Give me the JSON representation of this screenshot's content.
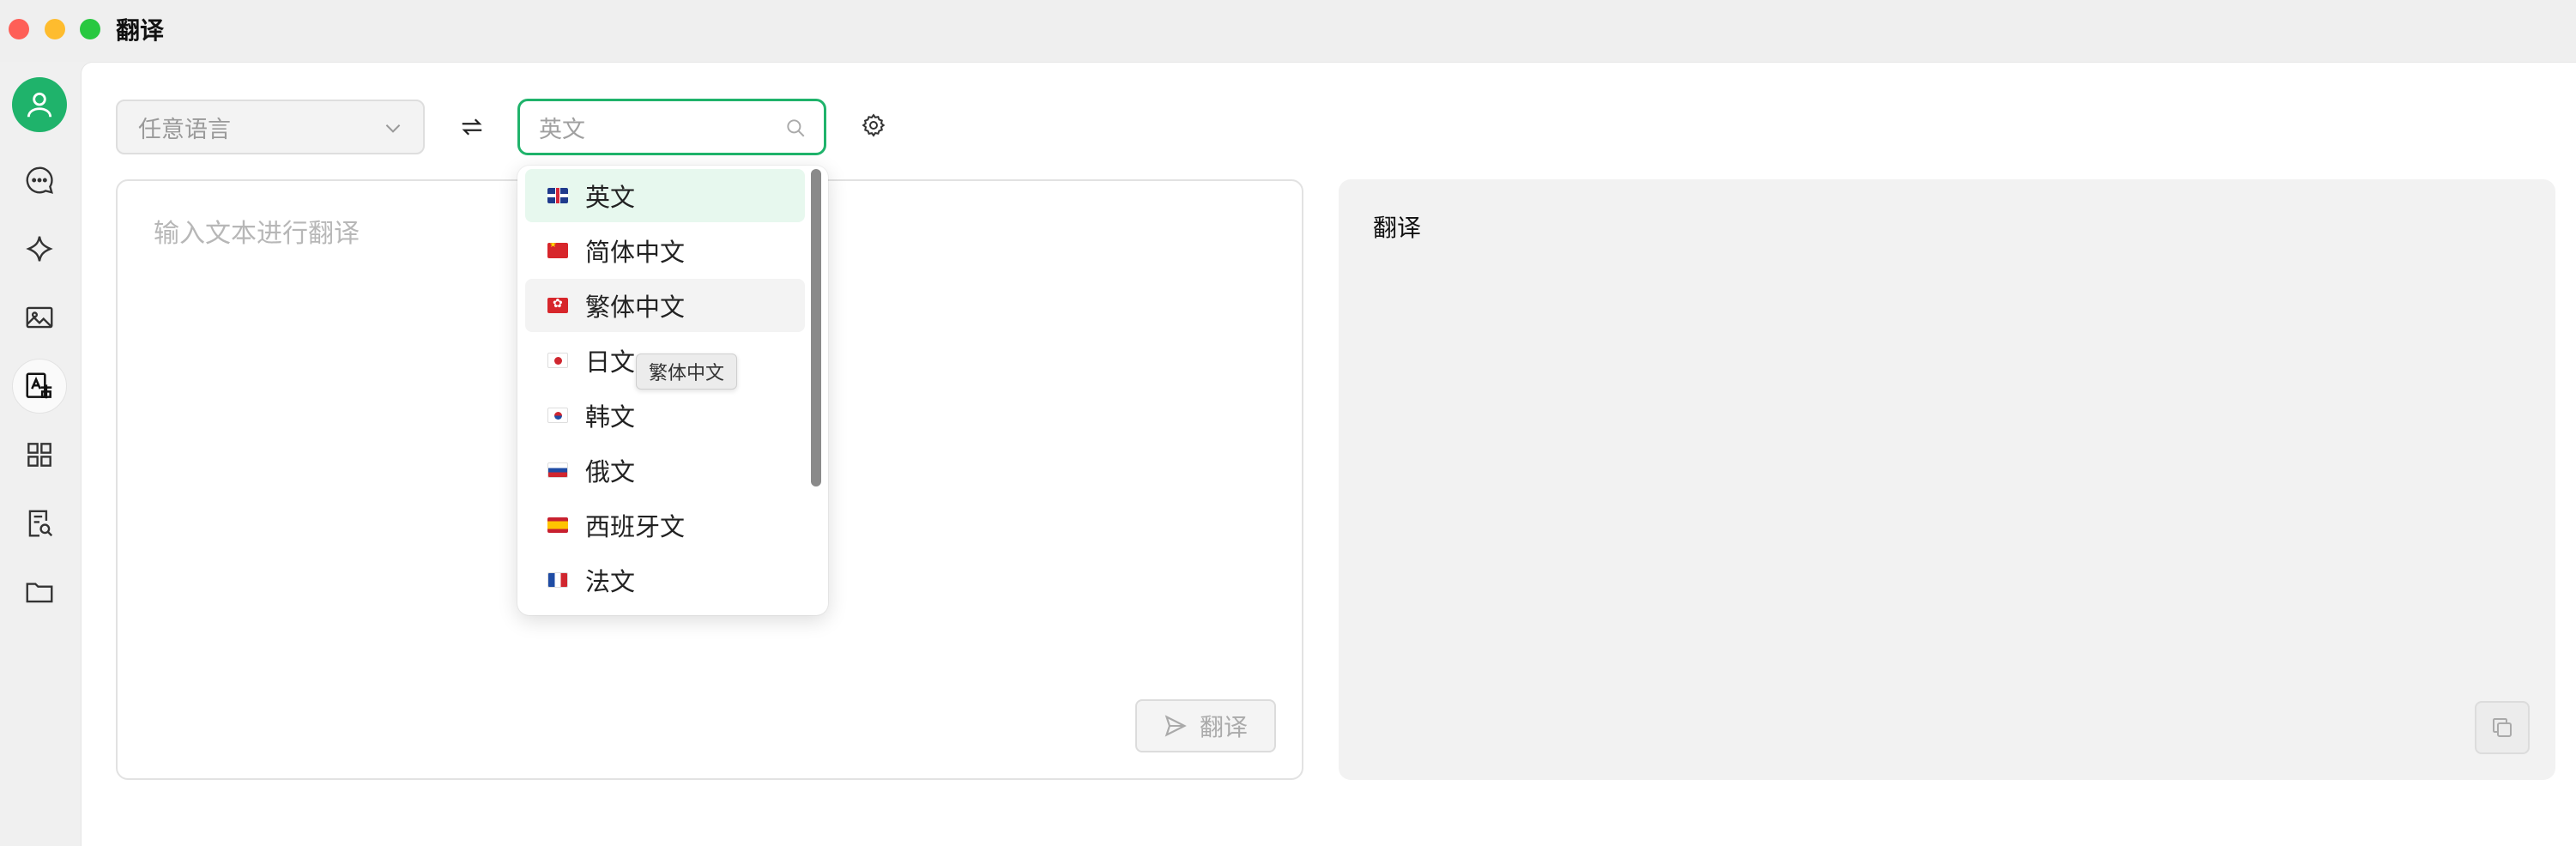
{
  "window": {
    "title": "翻译"
  },
  "sidebar": {
    "items": [
      {
        "name": "avatar",
        "icon": "user-icon"
      },
      {
        "name": "chat",
        "icon": "chat-bubble-icon"
      },
      {
        "name": "assistant",
        "icon": "sparkle-icon"
      },
      {
        "name": "image",
        "icon": "image-icon"
      },
      {
        "name": "translate",
        "icon": "translate-icon",
        "active": true
      },
      {
        "name": "apps",
        "icon": "grid-icon"
      },
      {
        "name": "knowledge",
        "icon": "document-search-icon"
      },
      {
        "name": "files",
        "icon": "folder-icon"
      }
    ]
  },
  "toolbar": {
    "source_language": "任意语言",
    "target_placeholder": "英文"
  },
  "input": {
    "placeholder": "输入文本进行翻译",
    "translate_label": "翻译"
  },
  "output": {
    "title": "翻译"
  },
  "dropdown": {
    "options": [
      {
        "label": "英文",
        "flag": "uk",
        "selected": true
      },
      {
        "label": "简体中文",
        "flag": "cn"
      },
      {
        "label": "繁体中文",
        "flag": "hk",
        "hovered": true
      },
      {
        "label": "日文",
        "flag": "jp"
      },
      {
        "label": "韩文",
        "flag": "kr"
      },
      {
        "label": "俄文",
        "flag": "ru"
      },
      {
        "label": "西班牙文",
        "flag": "es"
      },
      {
        "label": "法文",
        "flag": "fr"
      }
    ]
  },
  "tooltip": {
    "text": "繁体中文"
  },
  "colors": {
    "accent": "#1fb36b",
    "selected_bg": "#e7f8ee"
  }
}
